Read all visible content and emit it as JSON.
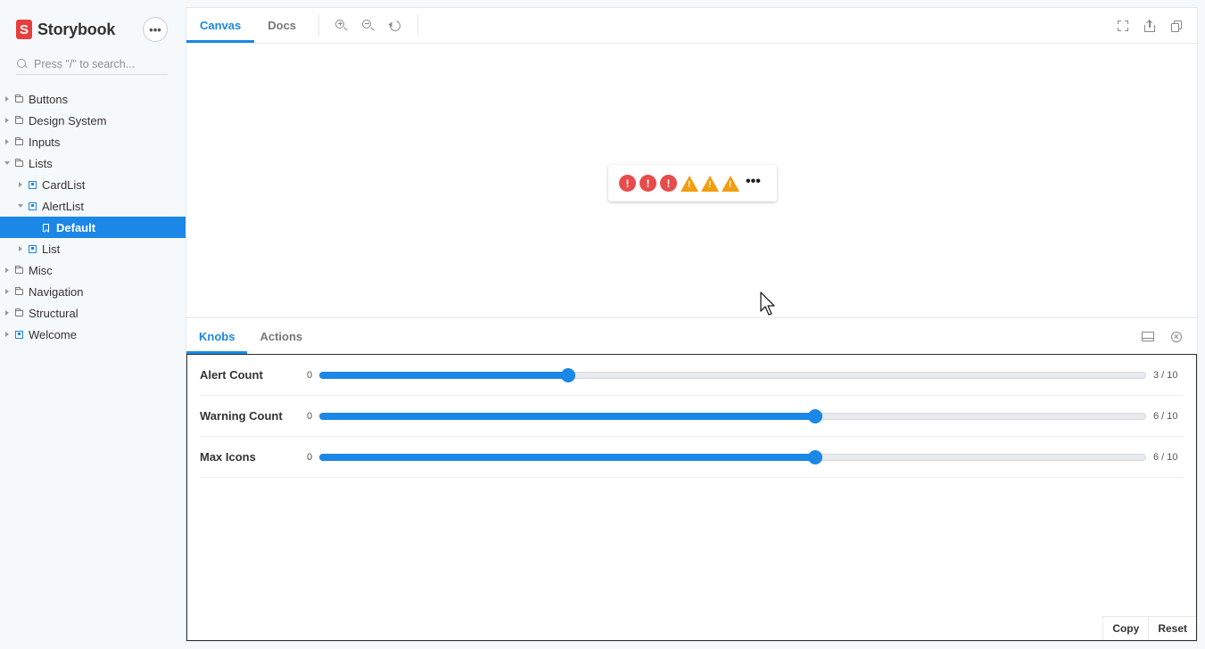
{
  "brand": {
    "name": "Storybook",
    "logo_letter": "S"
  },
  "search": {
    "placeholder": "Press \"/\" to search..."
  },
  "sidebar": {
    "items": [
      {
        "label": "Buttons"
      },
      {
        "label": "Design System"
      },
      {
        "label": "Inputs"
      },
      {
        "label": "Lists"
      },
      {
        "label": "CardList"
      },
      {
        "label": "AlertList"
      },
      {
        "label": "Default"
      },
      {
        "label": "List"
      },
      {
        "label": "Misc"
      },
      {
        "label": "Navigation"
      },
      {
        "label": "Structural"
      },
      {
        "label": "Welcome"
      }
    ]
  },
  "toolbar": {
    "tabs": [
      {
        "label": "Canvas"
      },
      {
        "label": "Docs"
      }
    ]
  },
  "preview": {
    "alert_glyph": "!",
    "warning_glyph": "!",
    "more_glyph": "•••",
    "alert_color": "#e74c4c",
    "warning_color": "#f29d12"
  },
  "panel": {
    "tabs": [
      {
        "label": "Knobs"
      },
      {
        "label": "Actions"
      }
    ]
  },
  "knobs": [
    {
      "label": "Alert Count",
      "min": "0",
      "value": 3,
      "max": 10,
      "display": "3 / 10"
    },
    {
      "label": "Warning Count",
      "min": "0",
      "value": 6,
      "max": 10,
      "display": "6 / 10"
    },
    {
      "label": "Max Icons",
      "min": "0",
      "value": 6,
      "max": 10,
      "display": "6 / 10"
    }
  ],
  "footer": {
    "copy_label": "Copy",
    "reset_label": "Reset"
  },
  "colors": {
    "accent": "#1b87e6",
    "brand": "#e53f3f"
  }
}
